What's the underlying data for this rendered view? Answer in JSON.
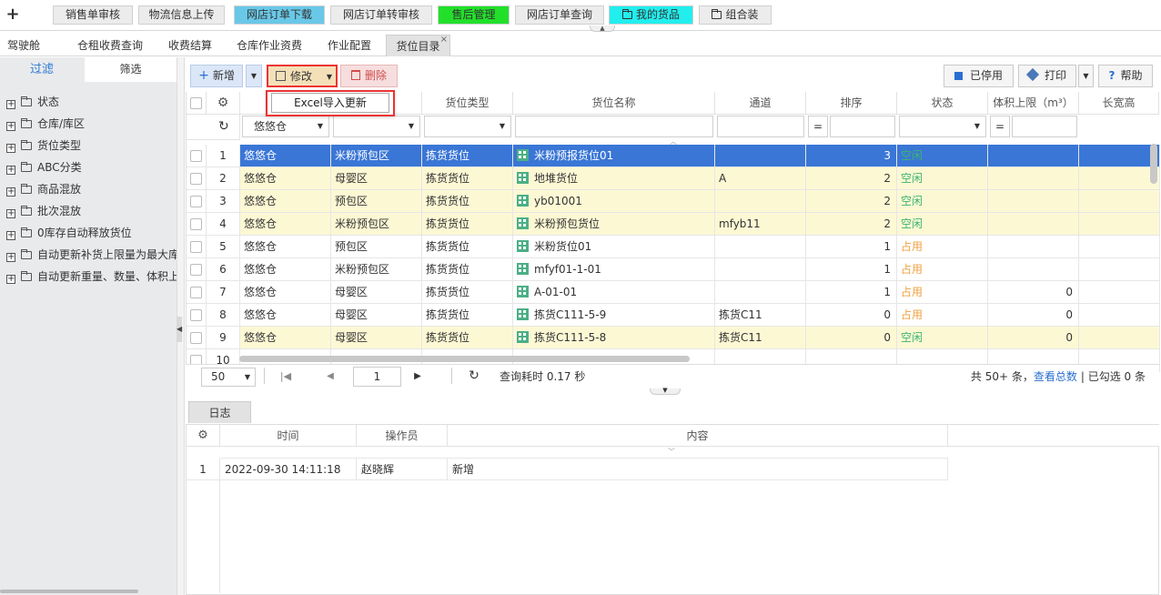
{
  "topbar": {
    "tabs": [
      {
        "label": "销售单审核",
        "bg": "#ececec"
      },
      {
        "label": "物流信息上传",
        "bg": "#ececec"
      },
      {
        "label": "网店订单下载",
        "bg": "#69c8e8"
      },
      {
        "label": "网店订单转审核",
        "bg": "#ececec"
      },
      {
        "label": "售后管理",
        "bg": "#22e02a"
      },
      {
        "label": "网店订单查询",
        "bg": "#ececec"
      },
      {
        "label": "我的货品",
        "bg": "#22eeee"
      },
      {
        "label": "组合装",
        "bg": "#ececec"
      }
    ]
  },
  "pagetabs": [
    "驾驶舱",
    "仓租收费查询",
    "收费结算",
    "仓库作业资费",
    "作业配置",
    "货位目录"
  ],
  "left": {
    "tab_filter": "过滤",
    "tab_screen": "筛选",
    "tree": [
      "状态",
      "仓库/库区",
      "货位类型",
      "ABC分类",
      "商品混放",
      "批次混放",
      "0库存自动释放货位",
      "自动更新补货上限量为最大库存",
      "自动更新重量、数量、体积上限"
    ]
  },
  "toolbar": {
    "new": "新增",
    "edit": "修改",
    "delete": "删除",
    "disabled": "已停用",
    "print": "打印",
    "help": "帮助",
    "dropdown_item": "Excel导入更新"
  },
  "grid": {
    "headers": [
      "货位类型",
      "货位名称",
      "通道",
      "排序",
      "状态",
      "体积上限（m³）",
      "长宽高"
    ],
    "filter_warehouse": "悠悠仓",
    "eq": "=",
    "rows": [
      {
        "n": "1",
        "wh": "悠悠仓",
        "zone": "米粉预包区",
        "type": "拣货货位",
        "name": "米粉预报货位01",
        "aisle": "",
        "sort": "3",
        "status": "空闲",
        "vol": "",
        "bg": "#3a76d6",
        "sel": true
      },
      {
        "n": "2",
        "wh": "悠悠仓",
        "zone": "母婴区",
        "type": "拣货货位",
        "name": "地堆货位",
        "aisle": "A",
        "sort": "2",
        "status": "空闲",
        "vol": "",
        "bg": "#fdf8d4"
      },
      {
        "n": "3",
        "wh": "悠悠仓",
        "zone": "预包区",
        "type": "拣货货位",
        "name": "yb01001",
        "aisle": "",
        "sort": "2",
        "status": "空闲",
        "vol": "",
        "bg": "#fdf8d4"
      },
      {
        "n": "4",
        "wh": "悠悠仓",
        "zone": "米粉预包区",
        "type": "拣货货位",
        "name": "米粉预包货位",
        "aisle": "mfyb11",
        "sort": "2",
        "status": "空闲",
        "vol": "",
        "bg": "#fdf8d4"
      },
      {
        "n": "5",
        "wh": "悠悠仓",
        "zone": "预包区",
        "type": "拣货货位",
        "name": "米粉货位01",
        "aisle": "",
        "sort": "1",
        "status": "占用",
        "vol": "",
        "bg": "#ffffff"
      },
      {
        "n": "6",
        "wh": "悠悠仓",
        "zone": "米粉预包区",
        "type": "拣货货位",
        "name": "mfyf01-1-01",
        "aisle": "",
        "sort": "1",
        "status": "占用",
        "vol": "",
        "bg": "#ffffff"
      },
      {
        "n": "7",
        "wh": "悠悠仓",
        "zone": "母婴区",
        "type": "拣货货位",
        "name": "A-01-01",
        "aisle": "",
        "sort": "1",
        "status": "占用",
        "vol": "0",
        "bg": "#ffffff"
      },
      {
        "n": "8",
        "wh": "悠悠仓",
        "zone": "母婴区",
        "type": "拣货货位",
        "name": "拣货C111-5-9",
        "aisle": "拣货C11",
        "sort": "0",
        "status": "占用",
        "vol": "0",
        "bg": "#ffffff"
      },
      {
        "n": "9",
        "wh": "悠悠仓",
        "zone": "母婴区",
        "type": "拣货货位",
        "name": "拣货C111-5-8",
        "aisle": "拣货C11",
        "sort": "0",
        "status": "空闲",
        "vol": "0",
        "bg": "#fdf8d4"
      },
      {
        "n": "10",
        "wh": "",
        "zone": "",
        "type": "",
        "name": "",
        "aisle": "",
        "sort": "",
        "status": "",
        "vol": "",
        "bg": "#ffffff"
      }
    ],
    "status_colors": {
      "空闲": "#3cb371",
      "占用": "#f0a040"
    }
  },
  "pager": {
    "page_size": "50",
    "page": "1",
    "query_time": "查询耗时 0.17 秒",
    "total": "共 50+ 条，",
    "view_total": "查看总数",
    "selected": "| 已勾选 0 条"
  },
  "log": {
    "tab": "日志",
    "headers": [
      "时间",
      "操作员",
      "内容"
    ],
    "rows": [
      {
        "n": "1",
        "time": "2022-09-30 14:11:18",
        "op": "赵晓辉",
        "content": "新增"
      }
    ]
  }
}
